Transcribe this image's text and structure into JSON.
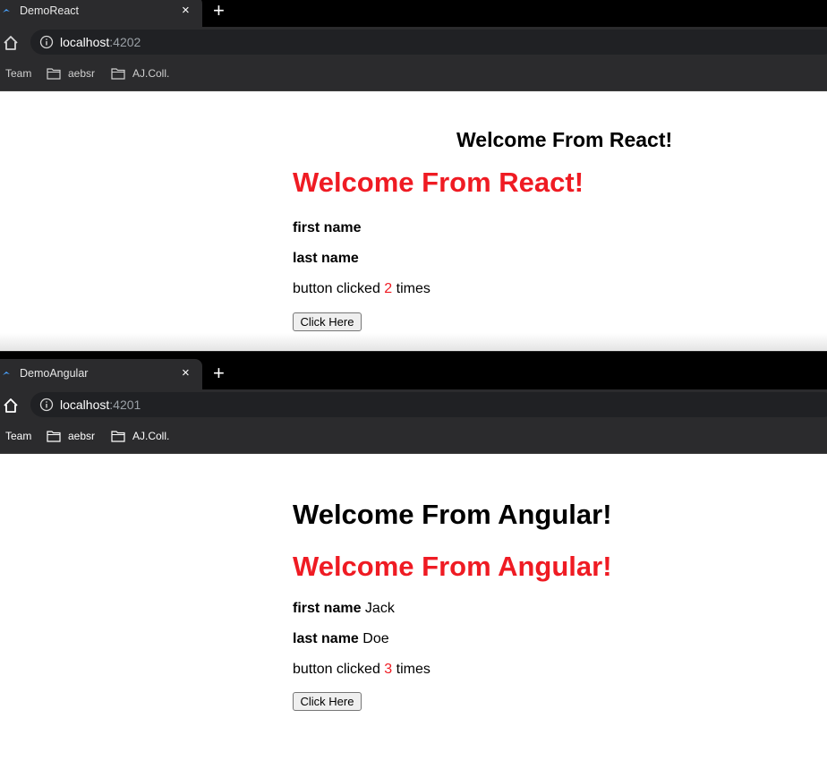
{
  "react_window": {
    "tab_title": "DemoReact",
    "tab_close": "×",
    "new_tab": "+",
    "url_host": "localhost",
    "url_port": ":4202",
    "bookmarks": [
      "Team",
      "aebsr",
      "AJ.Coll."
    ],
    "page": {
      "heading": "Welcome From React!",
      "subheading": "Welcome From React!",
      "first_name_label": "first name",
      "first_name_value": "",
      "last_name_label": "last name",
      "last_name_value": "",
      "clicked_prefix": "button clicked",
      "clicked_count": "2",
      "clicked_suffix": "times",
      "button_label": "Click Here"
    }
  },
  "angular_window": {
    "tab_title": "DemoAngular",
    "tab_close": "×",
    "new_tab": "+",
    "url_host": "localhost",
    "url_port": ":4201",
    "bookmarks": [
      "Team",
      "aebsr",
      "AJ.Coll."
    ],
    "page": {
      "heading": "Welcome From Angular!",
      "subheading": "Welcome From Angular!",
      "first_name_label": "first name",
      "first_name_value": "Jack",
      "last_name_label": "last name",
      "last_name_value": "Doe",
      "clicked_prefix": "button clicked",
      "clicked_count": "3",
      "clicked_suffix": "times",
      "button_label": "Click Here"
    }
  },
  "colors": {
    "accent_red": "#ef1b23",
    "chrome_dark": "#2b2b2d",
    "tabstrip": "#000000"
  }
}
